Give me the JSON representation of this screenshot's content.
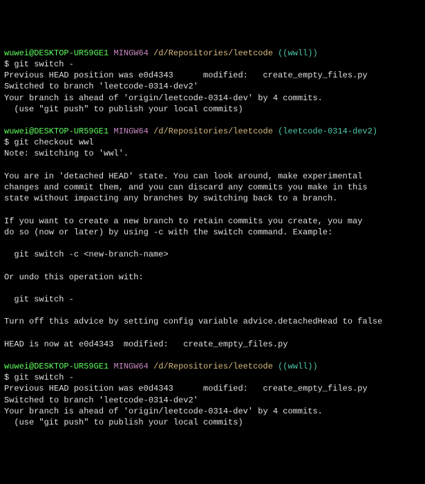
{
  "blocks": [
    {
      "prompt": {
        "userHost": "wuwei@DESKTOP-UR59GE1",
        "system": "MINGW64",
        "path": "/d/Repositories/leetcode",
        "branch": "((wwll))"
      },
      "command": "$ git switch -",
      "output": [
        "Previous HEAD position was e0d4343      modified:   create_empty_files.py",
        "Switched to branch 'leetcode-0314-dev2'",
        "Your branch is ahead of 'origin/leetcode-0314-dev' by 4 commits.",
        "  (use \"git push\" to publish your local commits)"
      ]
    },
    {
      "prompt": {
        "userHost": "wuwei@DESKTOP-UR59GE1",
        "system": "MINGW64",
        "path": "/d/Repositories/leetcode",
        "branch": "(leetcode-0314-dev2)"
      },
      "command": "$ git checkout wwl",
      "output": [
        "Note: switching to 'wwl'.",
        "",
        "You are in 'detached HEAD' state. You can look around, make experimental",
        "changes and commit them, and you can discard any commits you make in this",
        "state without impacting any branches by switching back to a branch.",
        "",
        "If you want to create a new branch to retain commits you create, you may",
        "do so (now or later) by using -c with the switch command. Example:",
        "",
        "  git switch -c <new-branch-name>",
        "",
        "Or undo this operation with:",
        "",
        "  git switch -",
        "",
        "Turn off this advice by setting config variable advice.detachedHead to false",
        "",
        "HEAD is now at e0d4343  modified:   create_empty_files.py"
      ]
    },
    {
      "prompt": {
        "userHost": "wuwei@DESKTOP-UR59GE1",
        "system": "MINGW64",
        "path": "/d/Repositories/leetcode",
        "branch": "((wwll))"
      },
      "command": "$ git switch -",
      "output": [
        "Previous HEAD position was e0d4343      modified:   create_empty_files.py",
        "Switched to branch 'leetcode-0314-dev2'",
        "Your branch is ahead of 'origin/leetcode-0314-dev' by 4 commits.",
        "  (use \"git push\" to publish your local commits)"
      ]
    }
  ]
}
